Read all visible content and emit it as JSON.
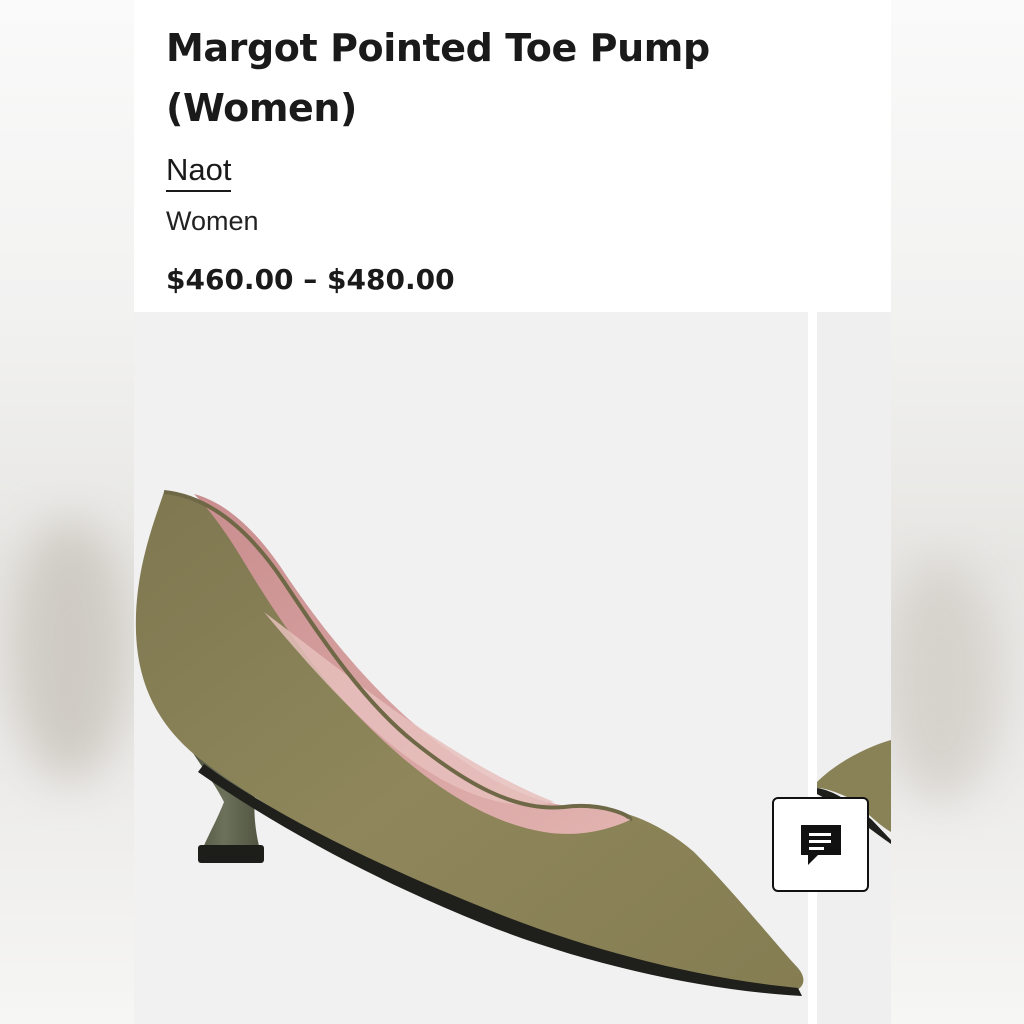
{
  "product": {
    "title": "Margot Pointed Toe Pump (Women)",
    "brand": "Naot",
    "category": "Women",
    "price": "$460.00 – $480.00"
  },
  "gallery": {
    "main_image": "olive-suede-pointed-toe-pump",
    "next_image": "olive-suede-pointed-toe-pump-partial"
  },
  "icons": {
    "chat": "chat-bubble-icon"
  },
  "colors": {
    "suede": "#8c8456",
    "lining": "#d9a3a2",
    "heel": "#5b5f48",
    "text": "#1a1a1a"
  }
}
